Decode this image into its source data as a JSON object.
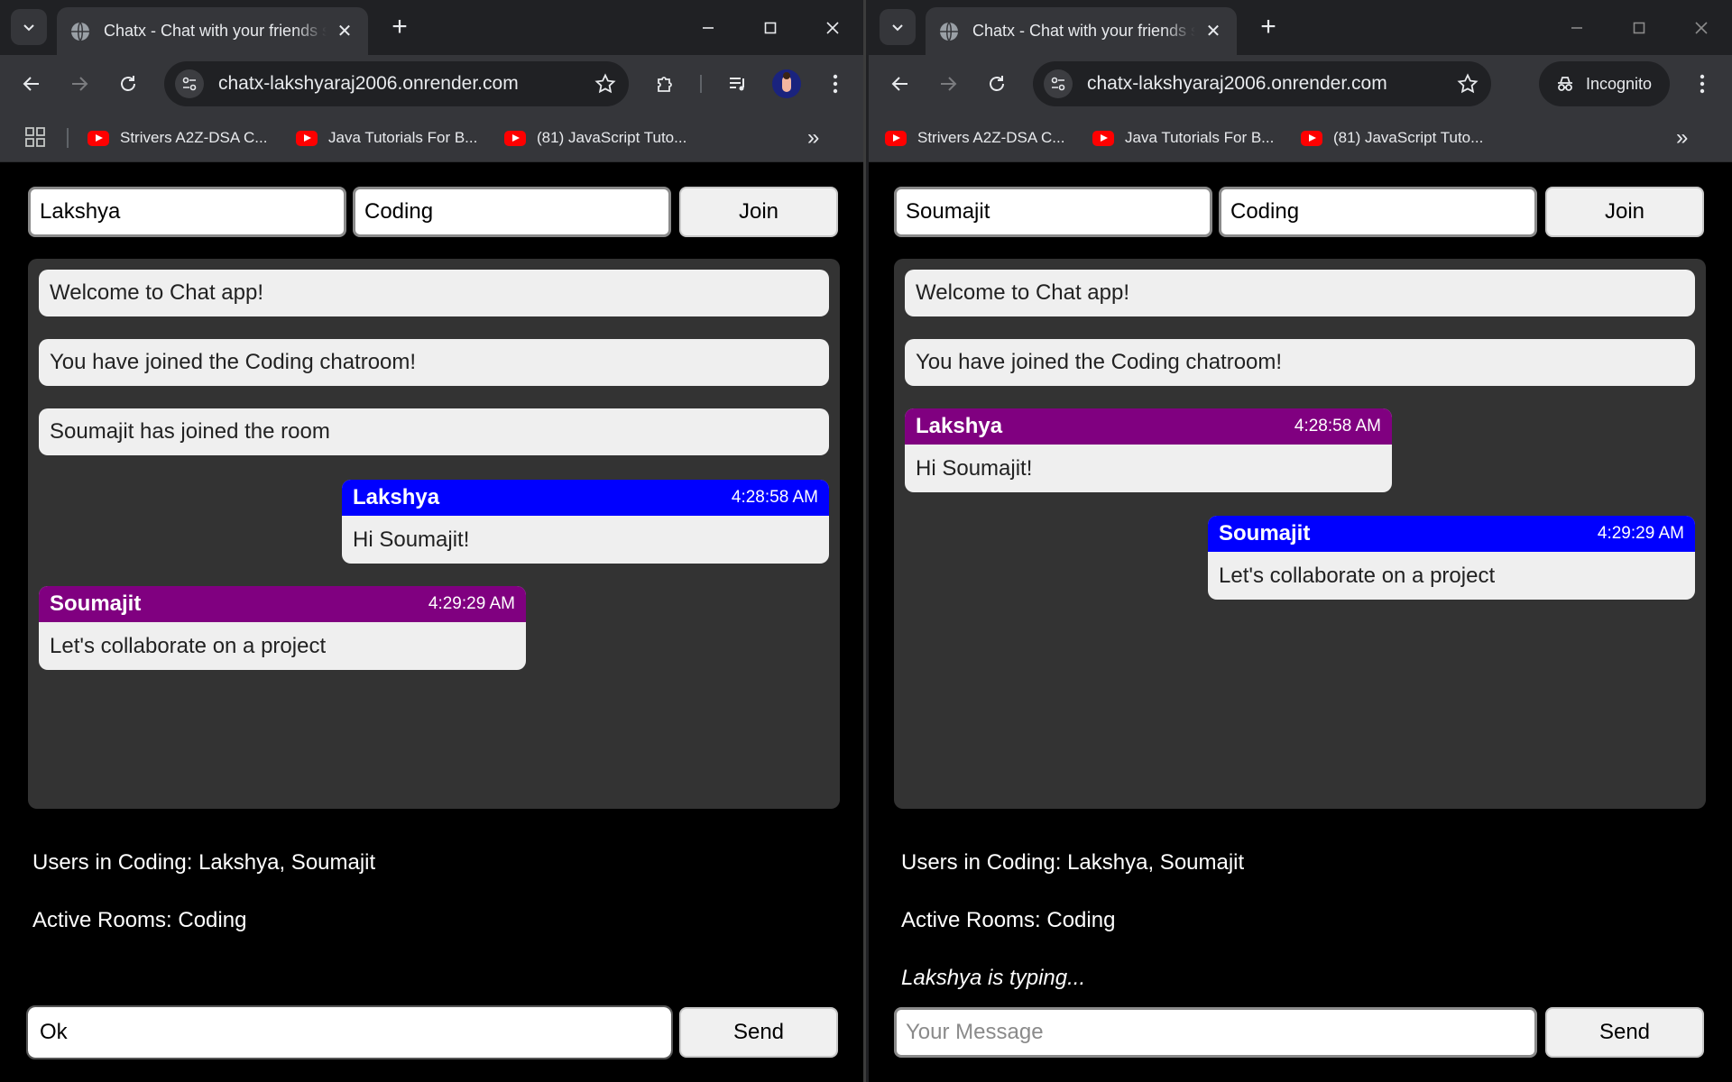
{
  "browser": {
    "tab_title": "Chatx - Chat with your friends seamlessly",
    "url": "chatx-lakshyaraj2006.onrender.com",
    "incognito_label": "Incognito",
    "bookmarks": [
      {
        "label": "Strivers A2Z-DSA C..."
      },
      {
        "label": "Java Tutorials For B..."
      },
      {
        "label": "(81) JavaScript Tuto..."
      }
    ]
  },
  "left": {
    "username": "Lakshya",
    "room": "Coding",
    "join_label": "Join",
    "system_messages": [
      "Welcome to Chat app!",
      "You have joined the Coding chatroom!",
      "Soumajit has joined the room"
    ],
    "messages": [
      {
        "user": "Lakshya",
        "time": "4:28:58 AM",
        "text": "Hi Soumajit!"
      },
      {
        "user": "Soumajit",
        "time": "4:29:29 AM",
        "text": "Let's collaborate on a project"
      }
    ],
    "users_info": "Users in Coding: Lakshya, Soumajit",
    "rooms_info": "Active Rooms: Coding",
    "message_value": "Ok",
    "send_label": "Send"
  },
  "right": {
    "username": "Soumajit",
    "room": "Coding",
    "join_label": "Join",
    "system_messages": [
      "Welcome to Chat app!",
      "You have joined the Coding chatroom!"
    ],
    "messages": [
      {
        "user": "Lakshya",
        "time": "4:28:58 AM",
        "text": "Hi Soumajit!"
      },
      {
        "user": "Soumajit",
        "time": "4:29:29 AM",
        "text": "Let's collaborate on a project"
      }
    ],
    "users_info": "Users in Coding: Lakshya, Soumajit",
    "rooms_info": "Active Rooms: Coding",
    "typing_status": "Lakshya is typing...",
    "message_placeholder": "Your Message",
    "send_label": "Send"
  },
  "colors": {
    "self_header": "#0000ff",
    "other_header": "#800080",
    "chat_box": "#333333",
    "page_background": "#000000"
  }
}
